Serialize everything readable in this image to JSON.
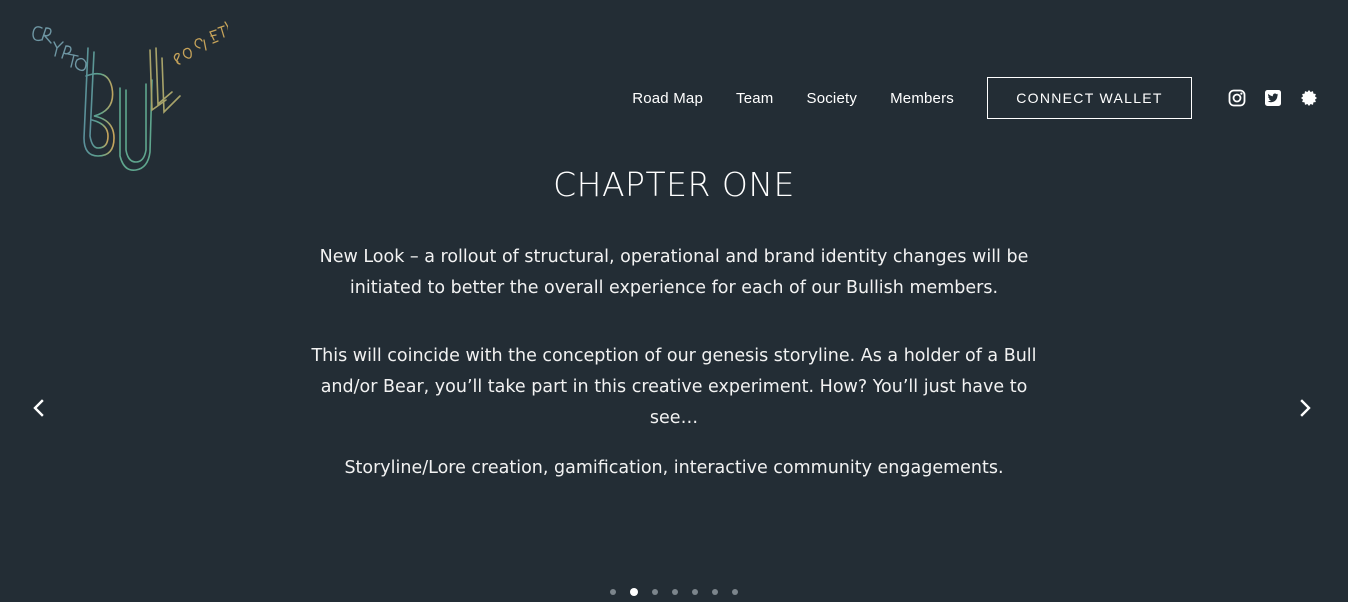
{
  "colors": {
    "background": "#232d35",
    "text": "#ffffff",
    "logo_teal": "#4a9c95",
    "logo_gold": "#c6a35a"
  },
  "logo": {
    "letters": [
      "C",
      "R",
      "Y",
      "P",
      "T",
      "O",
      "B",
      "U",
      "L",
      "L",
      "S",
      "O",
      "C",
      "I",
      "E",
      "T",
      "Y"
    ]
  },
  "nav": {
    "links": [
      {
        "label": "Road Map"
      },
      {
        "label": "Team"
      },
      {
        "label": "Society"
      },
      {
        "label": "Members"
      }
    ],
    "connect_label": "CONNECT WALLET",
    "social_icons": [
      "instagram-icon",
      "twitter-icon",
      "opensea-icon"
    ]
  },
  "slide": {
    "title": "CHAPTER ONE",
    "paragraphs": [
      "New Look – a rollout of structural, operational and brand identity changes will be initiated to better the overall experience for each of our Bullish members.",
      "This will coincide with the conception of our genesis storyline. As a holder of a Bull and/or Bear, you’ll take part in this creative experiment. How? You’ll just have to see…",
      "Storyline/Lore creation, gamification, interactive community engagements."
    ]
  },
  "carousel": {
    "slide_count": 7,
    "active_index": 1,
    "prev_icon": "chevron-left-icon",
    "next_icon": "chevron-right-icon"
  }
}
